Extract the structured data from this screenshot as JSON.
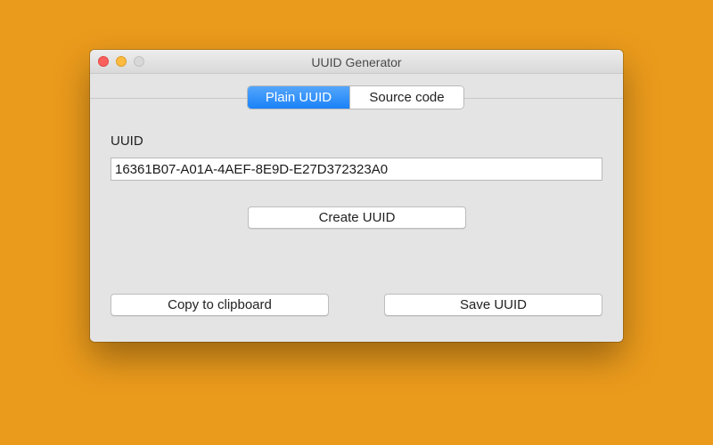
{
  "window": {
    "title": "UUID Generator",
    "controls": [
      "close",
      "minimize",
      "zoom"
    ]
  },
  "tabs": [
    {
      "label": "Plain UUID",
      "selected": true
    },
    {
      "label": "Source code",
      "selected": false
    }
  ],
  "uuid": {
    "label": "UUID",
    "value": "16361B07-A01A-4AEF-8E9D-E27D372323A0"
  },
  "buttons": {
    "create": "Create UUID",
    "copy": "Copy to clipboard",
    "save": "Save UUID"
  },
  "colors": {
    "desktop_background": "#EB9B1C",
    "accent": "#1A82F9",
    "close": "#FC605C",
    "minimize": "#FDBC40"
  }
}
